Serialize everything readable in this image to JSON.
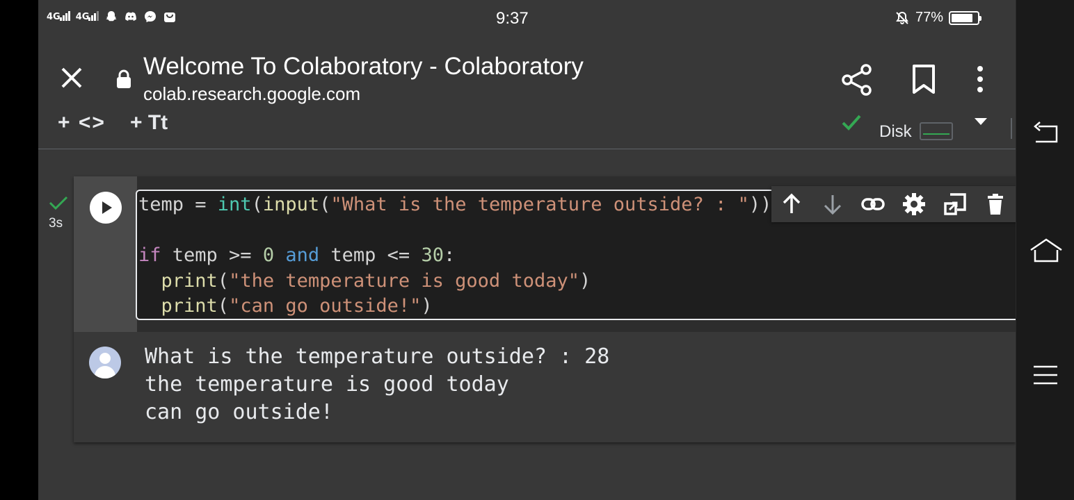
{
  "status_bar": {
    "signal1": "4G",
    "signal2": "4G",
    "time": "9:37",
    "battery": "77%",
    "icons": [
      "snapchat-icon",
      "discord-icon",
      "messenger-icon",
      "shop-icon",
      "mute-icon",
      "battery-icon"
    ]
  },
  "browser": {
    "title": "Welcome To Colaboratory - Colaboratory",
    "url": "colab.research.google.com",
    "icons": [
      "close-icon",
      "lock-icon",
      "share-icon",
      "bookmark-icon",
      "more-vert-icon"
    ]
  },
  "colab_toolbar": {
    "add_code": "+ <>",
    "add_text": "+ Tt",
    "disk_label": "Disk"
  },
  "cell": {
    "exec_time": "3s",
    "code_lines": [
      "temp = int(input(\"What is the temperature outside? : \"))",
      "",
      "if temp >= 0 and temp <= 30:",
      "  print(\"the temperature is good today\")",
      "  print(\"can go outside!\")"
    ],
    "toolbar_icons": [
      "move-up-icon",
      "move-down-icon",
      "link-icon",
      "settings-icon",
      "mirror-cell-icon",
      "delete-icon",
      "more-vert-icon"
    ],
    "output_lines": [
      "What is the temperature outside? : 28",
      "the temperature is good today",
      "can go outside!"
    ]
  },
  "colors": {
    "background": "#383838",
    "editor_bg": "#1e1e1e",
    "keyword": "#c586c0",
    "string": "#ce9178",
    "function": "#dcdcaa",
    "number": "#b5cea8",
    "success_green": "#34a853"
  }
}
